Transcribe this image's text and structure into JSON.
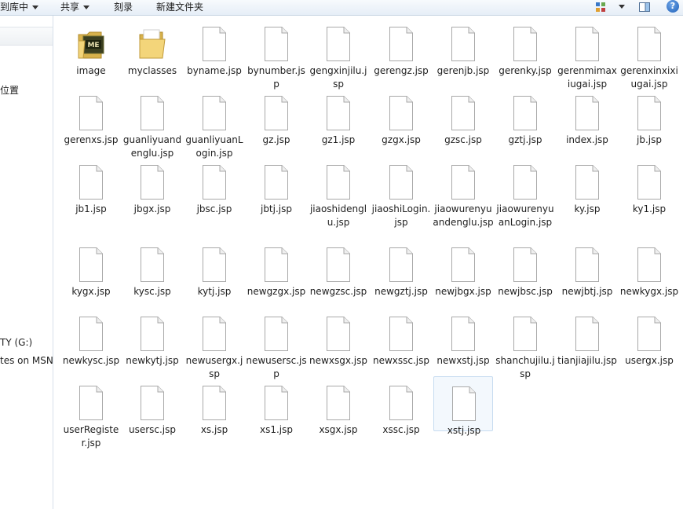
{
  "toolbar": {
    "include_in_library": "到库中",
    "share": "共享",
    "burn": "刻录",
    "new_folder": "新建文件夹",
    "help": "?"
  },
  "nav": {
    "items": [
      {
        "label": "位置"
      },
      {
        "label": "TY (G:)"
      },
      {
        "label": "tes on MSN"
      }
    ]
  },
  "files": [
    {
      "name": "image",
      "type": "folder-image"
    },
    {
      "name": "myclasses",
      "type": "folder"
    },
    {
      "name": "byname.jsp",
      "type": "file"
    },
    {
      "name": "bynumber.jsp",
      "type": "file"
    },
    {
      "name": "gengxinjilu.jsp",
      "type": "file"
    },
    {
      "name": "gerengz.jsp",
      "type": "file"
    },
    {
      "name": "gerenjb.jsp",
      "type": "file"
    },
    {
      "name": "gerenky.jsp",
      "type": "file"
    },
    {
      "name": "gerenmimaxiugai.jsp",
      "type": "file"
    },
    {
      "name": "gerenxinxixiugai.jsp",
      "type": "file"
    },
    {
      "name": "gerenxs.jsp",
      "type": "file"
    },
    {
      "name": "guanliyuandenglu.jsp",
      "type": "file"
    },
    {
      "name": "guanliyuanLogin.jsp",
      "type": "file"
    },
    {
      "name": "gz.jsp",
      "type": "file"
    },
    {
      "name": "gz1.jsp",
      "type": "file"
    },
    {
      "name": "gzgx.jsp",
      "type": "file"
    },
    {
      "name": "gzsc.jsp",
      "type": "file"
    },
    {
      "name": "gztj.jsp",
      "type": "file"
    },
    {
      "name": "index.jsp",
      "type": "file"
    },
    {
      "name": "jb.jsp",
      "type": "file"
    },
    {
      "name": "jb1.jsp",
      "type": "file"
    },
    {
      "name": "jbgx.jsp",
      "type": "file"
    },
    {
      "name": "jbsc.jsp",
      "type": "file"
    },
    {
      "name": "jbtj.jsp",
      "type": "file"
    },
    {
      "name": "jiaoshidenglu.jsp",
      "type": "file"
    },
    {
      "name": "jiaoshiLogin.jsp",
      "type": "file"
    },
    {
      "name": "jiaowurenyuandenglu.jsp",
      "type": "file"
    },
    {
      "name": "jiaowurenyuanLogin.jsp",
      "type": "file"
    },
    {
      "name": "ky.jsp",
      "type": "file"
    },
    {
      "name": "ky1.jsp",
      "type": "file"
    },
    {
      "name": "kygx.jsp",
      "type": "file"
    },
    {
      "name": "kysc.jsp",
      "type": "file"
    },
    {
      "name": "kytj.jsp",
      "type": "file"
    },
    {
      "name": "newgzgx.jsp",
      "type": "file"
    },
    {
      "name": "newgzsc.jsp",
      "type": "file"
    },
    {
      "name": "newgztj.jsp",
      "type": "file"
    },
    {
      "name": "newjbgx.jsp",
      "type": "file"
    },
    {
      "name": "newjbsc.jsp",
      "type": "file"
    },
    {
      "name": "newjbtj.jsp",
      "type": "file"
    },
    {
      "name": "newkygx.jsp",
      "type": "file"
    },
    {
      "name": "newkysc.jsp",
      "type": "file"
    },
    {
      "name": "newkytj.jsp",
      "type": "file"
    },
    {
      "name": "newusergx.jsp",
      "type": "file"
    },
    {
      "name": "newusersc.jsp",
      "type": "file"
    },
    {
      "name": "newxsgx.jsp",
      "type": "file"
    },
    {
      "name": "newxssc.jsp",
      "type": "file"
    },
    {
      "name": "newxstj.jsp",
      "type": "file"
    },
    {
      "name": "shanchujilu.jsp",
      "type": "file"
    },
    {
      "name": "tianjiajilu.jsp",
      "type": "file"
    },
    {
      "name": "usergx.jsp",
      "type": "file"
    },
    {
      "name": "userRegister.jsp",
      "type": "file"
    },
    {
      "name": "usersc.jsp",
      "type": "file"
    },
    {
      "name": "xs.jsp",
      "type": "file"
    },
    {
      "name": "xs1.jsp",
      "type": "file"
    },
    {
      "name": "xsgx.jsp",
      "type": "file"
    },
    {
      "name": "xssc.jsp",
      "type": "file"
    },
    {
      "name": "xstj.jsp",
      "type": "file",
      "selected": true
    }
  ]
}
